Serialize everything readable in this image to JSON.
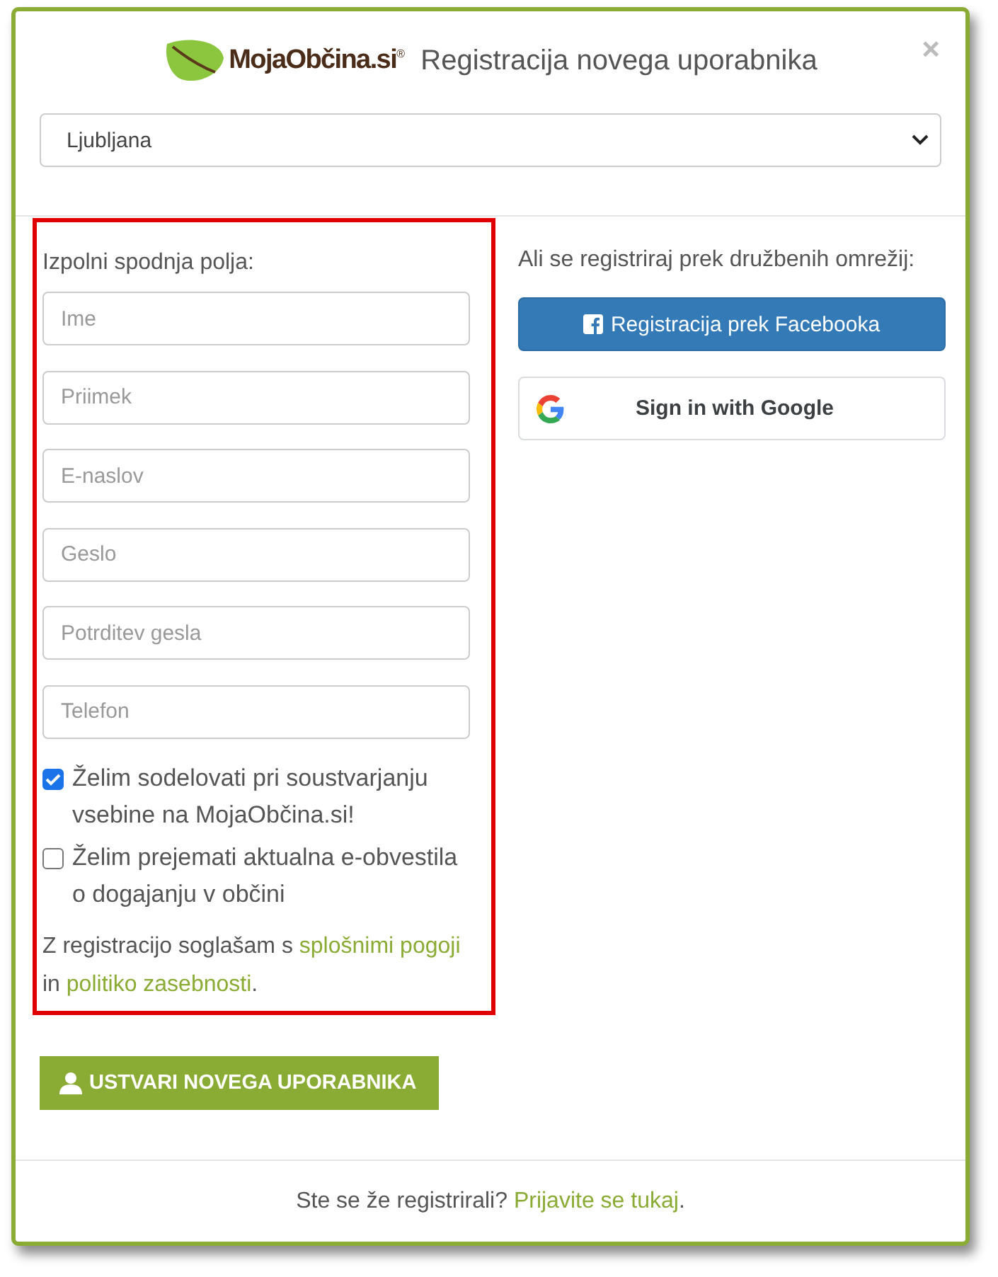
{
  "header": {
    "logo_text": "MojaObčina.si$^{®}$",
    "title": "Registracija novega uporabnika",
    "close": "×"
  },
  "municipality_select": {
    "value": "Ljubljana"
  },
  "form": {
    "heading": "Izpolni spodnja polja:",
    "fields": [
      {
        "placeholder": "Ime"
      },
      {
        "placeholder": "Priimek"
      },
      {
        "placeholder": "E-naslov"
      },
      {
        "placeholder": "Geslo"
      },
      {
        "placeholder": "Potrditev gesla"
      },
      {
        "placeholder": "Telefon"
      }
    ],
    "checkboxes": [
      {
        "label": "Želim sodelovati pri soustvarjanju vsebine na MojaObčina.si!",
        "checked": true
      },
      {
        "label": "Želim prejemati aktualna e-obvestila o dogajanju v občini",
        "checked": false
      }
    ],
    "terms": {
      "before": "Z registracijo soglašam s",
      "link1": "splošnimi pogoji",
      "middle": "in",
      "link2": "politiko zasebnosti",
      "after": "."
    },
    "submit": "USTVARI NOVEGA UPORABNIKA"
  },
  "social": {
    "heading": "Ali se registriraj prek družbenih omrežij:",
    "facebook": "Registracija prek Facebooka",
    "google": "Sign in with Google"
  },
  "footer": {
    "text": "Ste se že registrirali?",
    "link": "Prijavite se tukaj",
    "after": "."
  }
}
